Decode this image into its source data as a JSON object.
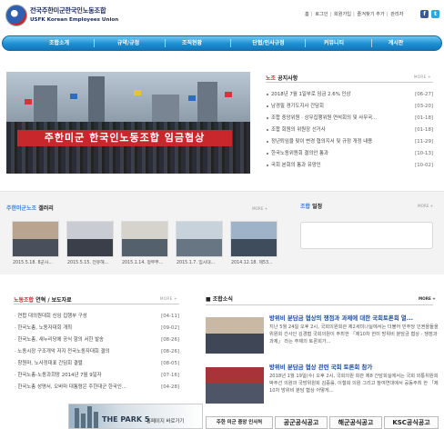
{
  "header": {
    "title": "전국주한미군한국인노동조합",
    "subtitle": "USFK Korean Employees Union",
    "top_links": [
      "홈",
      "로그인",
      "회원가입",
      "즐겨찾기 추가",
      "관리자"
    ],
    "sns": [
      "facebook-icon",
      "twitter-icon"
    ]
  },
  "nav": [
    "조합소개",
    "규약/규정",
    "조직현황",
    "단협/인사규정",
    "커뮤니티",
    "게시판"
  ],
  "hero": {
    "banner_text": "주한미군 한국인노동조합 임금협상"
  },
  "notice": {
    "title_accent": "노조",
    "title": "공지사항",
    "more": "MORE +",
    "items": [
      {
        "text": "2018년 7월 1일부로 임금 2.6% 인상",
        "date": "[06-27]"
      },
      {
        "text": "남경필 경기도지사 간담회",
        "date": "[03-20]"
      },
      {
        "text": "조합 중앙위원 · 상무집행위원 연석회의 및 사무국...",
        "date": "[01-18]"
      },
      {
        "text": "조합 회원의 위원장 선거사",
        "date": "[01-18]"
      },
      {
        "text": "정년퇴임을 맞이 변경 협의지서 및 규정 개정 내용",
        "date": "[11-29]"
      },
      {
        "text": "한국노동위원회 결의안 통과",
        "date": "[10-13]"
      },
      {
        "text": "국회 본회의 통과 유망인",
        "date": "[10-02]"
      }
    ]
  },
  "gallery": {
    "title_accent": "주한미군노조",
    "title": "갤러리",
    "more": "MORE +",
    "items": [
      {
        "caption": "2015.5.18. 8군사..."
      },
      {
        "caption": "2015.5.15. 전유해..."
      },
      {
        "caption": "2015.1.14. 정부부..."
      },
      {
        "caption": "2015.1.7. 임시대..."
      },
      {
        "caption": "2014.12.18. 제53..."
      }
    ]
  },
  "join": {
    "title_accent": "조합",
    "title": "일정",
    "more": "MORE +"
  },
  "press": {
    "title_accent": "노동조합",
    "title": "연혁 / 보도자료",
    "more": "MORE +",
    "items": [
      {
        "text": "· 연합 대의원대회 신임 집행부 구성",
        "date": "[04-11]"
      },
      {
        "text": "· 한국노총, 노동자대회 개최",
        "date": "[09-02]"
      },
      {
        "text": "· 한국노총, 새누리당에 공식 항의 서한 발송",
        "date": "[08-26]"
      },
      {
        "text": "· 노동시장 구조개악 저지 전국노동자대회 결의",
        "date": "[08-26]"
      },
      {
        "text": "· 창원마, 노사정대표 간담회 결렬",
        "date": "[08-05]"
      },
      {
        "text": "· 한국노총-노동과희망 2014년 7월 9일자",
        "date": "[07-16]"
      },
      {
        "text": "· 한국노총 성명서, 오바마 대통령은 주한대군 한국인...",
        "date": "[04-28]"
      }
    ]
  },
  "ad": {
    "headline": "THE PARK 5",
    "tagline": "홍페이지 바로가기"
  },
  "news": {
    "title": "조합소식",
    "more": "MORE +",
    "items": [
      {
        "title": "방위비 분담금 협상의 쟁점과 과제에 대한 국회토론회 열...",
        "body": "지난 5월 24일 오후 2시, 국회의원회관 제2세미나실에서는 더불어 민주당 인권을들을 위원회 간사인 김경협 국회의원이 주최한 「제10차 한미 방위비 분담금 협상 - 쟁점과 과제」 라는 주제의 토론회가..."
      },
      {
        "title": "방위비 분담금 협상 관련 국회 토론회 참가",
        "body": "2018년 1월 19일(수) 오후 2시, 국회의원 회관 제8 간담회실에서는 국회 외통위원회 박주선 의원과 국방위원회 김중률, 이철희 의원 그리고 참여연대에서 공동주최 한 「제10차 방위비 분담 협상 어떻게..."
      }
    ]
  },
  "bottom_buttons": [
    "주한 미군 중앙 인사처",
    "공군공식공고",
    "해군공식공고",
    "KSC공식공고"
  ]
}
